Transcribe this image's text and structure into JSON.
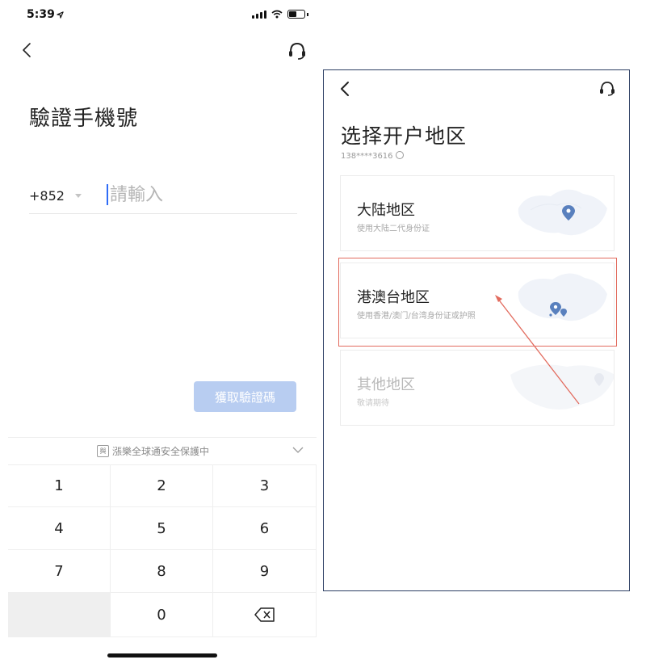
{
  "left_screen": {
    "status_bar": {
      "time": "5:39"
    },
    "title": "驗證手機號",
    "phone": {
      "country_code": "+852",
      "placeholder": "請輸入",
      "value": ""
    },
    "get_code_label": "獲取驗證碼",
    "keypad": {
      "badge": "與",
      "security_text": "漲樂全球通安全保護中",
      "keys": [
        "1",
        "2",
        "3",
        "4",
        "5",
        "6",
        "7",
        "8",
        "9",
        "",
        "0",
        "⌫"
      ]
    }
  },
  "right_screen": {
    "title": "选择开户地区",
    "masked_phone": "138****3616",
    "regions": [
      {
        "name": "大陆地区",
        "desc": "使用大陆二代身份证",
        "enabled": true
      },
      {
        "name": "港澳台地区",
        "desc": "使用香港/澳门/台湾身份证或护照",
        "enabled": true,
        "highlighted": true
      },
      {
        "name": "其他地区",
        "desc": "敬请期待",
        "enabled": false
      }
    ]
  },
  "colors": {
    "accent": "#2f6cf6",
    "button_disabled": "#b8cdf1",
    "pin": "#3d6bb3",
    "annotation": "#e26b5e",
    "frame_border": "#2c3e63"
  }
}
